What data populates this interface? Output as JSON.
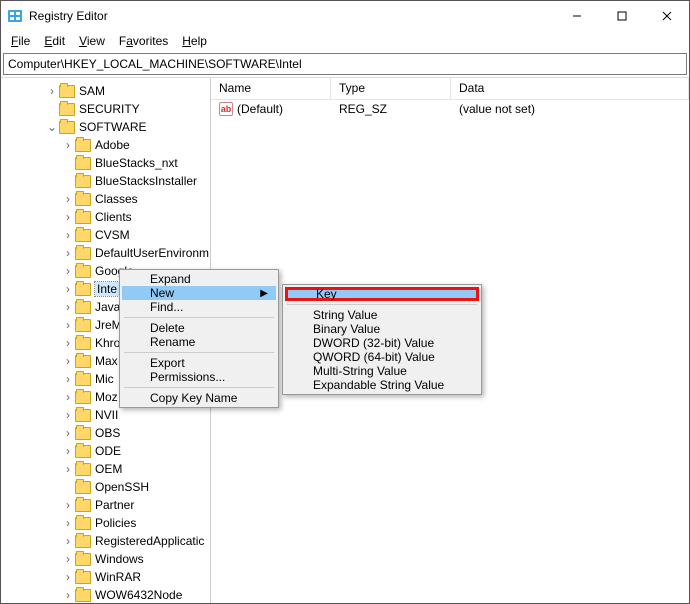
{
  "window": {
    "title": "Registry Editor"
  },
  "menubar": {
    "file": "File",
    "edit": "Edit",
    "view": "View",
    "favorites": "Favorites",
    "help": "Help"
  },
  "address": "Computer\\HKEY_LOCAL_MACHINE\\SOFTWARE\\Intel",
  "columns": {
    "name": "Name",
    "type": "Type",
    "data": "Data"
  },
  "row0": {
    "name": "(Default)",
    "type": "REG_SZ",
    "data": "(value not set)"
  },
  "tree": {
    "sam": "SAM",
    "security": "SECURITY",
    "software": "SOFTWARE",
    "adobe": "Adobe",
    "bluestacks_nxt": "BlueStacks_nxt",
    "bluestacksinstaller": "BlueStacksInstaller",
    "classes": "Classes",
    "clients": "Clients",
    "cvsm": "CVSM",
    "defaultuserenv": "DefaultUserEnvironm",
    "google": "Google",
    "intel": "Inte",
    "javasoft": "Java",
    "jre": "JreM",
    "khronos": "Khro",
    "maxon": "Max",
    "microsoft": "Mic",
    "mozilla": "Moz",
    "nvidia": "NVII",
    "obs": "OBS",
    "ode": "ODE",
    "oem": "OEM",
    "openssh": "OpenSSH",
    "partner": "Partner",
    "policies": "Policies",
    "registeredapps": "RegisteredApplicatic",
    "windows": "Windows",
    "winrar": "WinRAR",
    "wow64": "WOW6432Node"
  },
  "ctx": {
    "expand": "Expand",
    "new": "New",
    "find": "Find...",
    "delete": "Delete",
    "rename": "Rename",
    "export": "Export",
    "permissions": "Permissions...",
    "copykey": "Copy Key Name"
  },
  "submenu": {
    "key": "Key",
    "string": "String Value",
    "binary": "Binary Value",
    "dword": "DWORD (32-bit) Value",
    "qword": "QWORD (64-bit) Value",
    "multi": "Multi-String Value",
    "expand": "Expandable String Value"
  }
}
